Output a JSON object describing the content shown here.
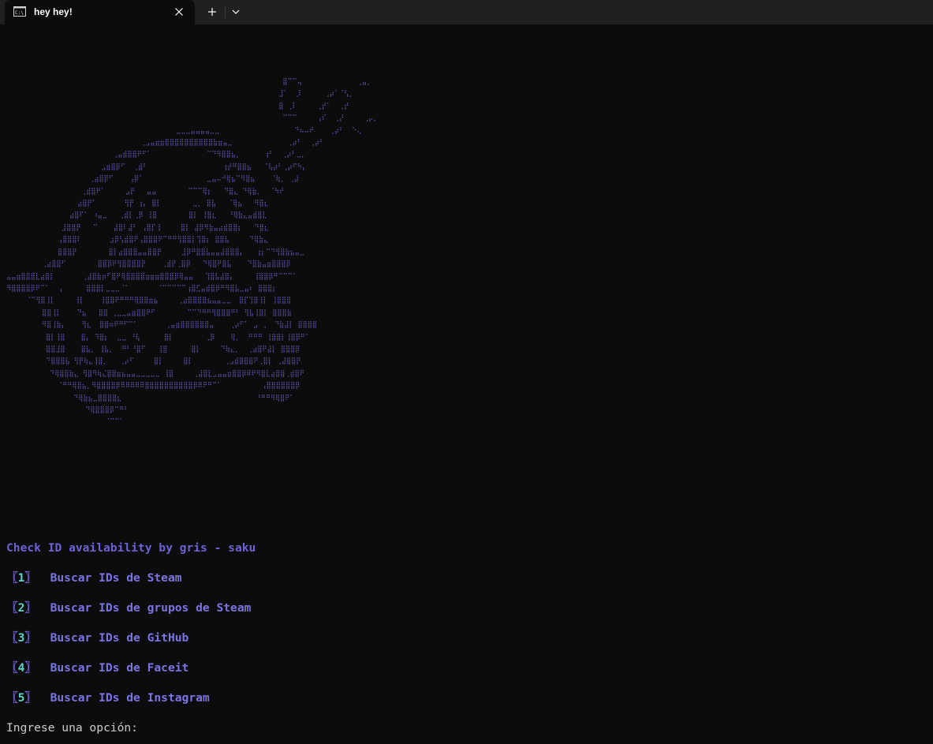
{
  "window": {
    "tab_title": "hey hey!",
    "tab_icon": "terminal-icon",
    "close_icon": "close-icon",
    "new_tab_icon": "plus-icon",
    "dropdown_icon": "chevron-down-icon"
  },
  "terminal": {
    "heading": "Check ID availability by gris - saku",
    "options": [
      {
        "open": "〖",
        "num": "1",
        "close": "〗",
        "label": "Buscar IDs de Steam"
      },
      {
        "open": "〖",
        "num": "2",
        "close": "〗",
        "label": "Buscar IDs de grupos de Steam"
      },
      {
        "open": "〖",
        "num": "3",
        "close": "〗",
        "label": "Buscar IDs de GitHub"
      },
      {
        "open": "〖",
        "num": "4",
        "close": "〗",
        "label": "Buscar IDs de Faceit"
      },
      {
        "open": "〖",
        "num": "5",
        "close": "〗",
        "label": "Buscar IDs de Instagram"
      }
    ],
    "prompt": "Ingrese una opción:"
  },
  "colors": {
    "background": "#0c0c0c",
    "titlebar": "#202020",
    "art": "#6b62d4",
    "option_label": "#7a74e6",
    "option_number": "#5fd3c7",
    "prompt": "#cccccc"
  }
}
